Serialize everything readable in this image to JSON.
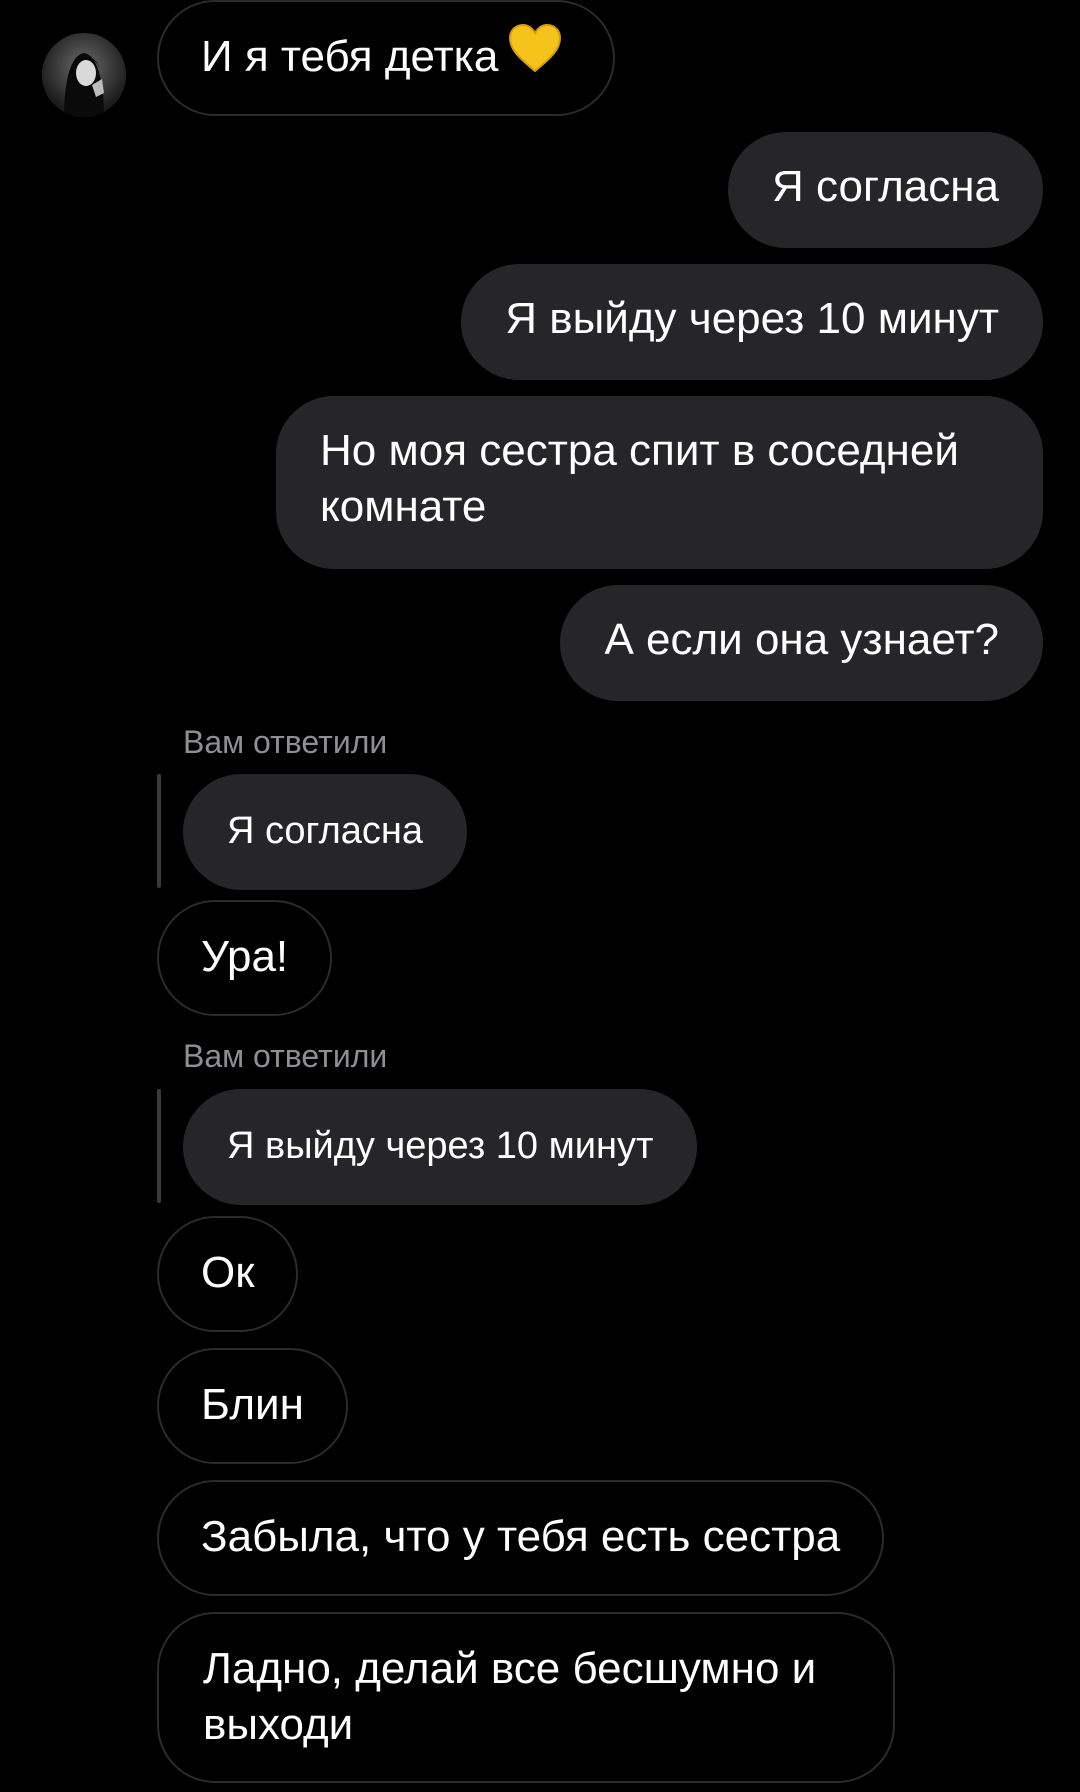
{
  "messages": {
    "m1": "И я тебя детка",
    "m2": "Я согласна",
    "m3": "Я выйду через 10 минут",
    "m4": "Но моя сестра спит в соседней комнате",
    "m5": "А если она узнает?",
    "reply1_label": "Вам ответили",
    "reply1_quote": "Я согласна",
    "m6": "Ура!",
    "reply2_label": "Вам ответили",
    "reply2_quote": "Я выйду через 10 минут",
    "m7": "Ок",
    "m8": "Блин",
    "m9": "Забыла, что у тебя есть сестра",
    "m10": "Ладно, делай все бесшумно и выходи"
  },
  "icons": {
    "heart": "yellow-heart-icon",
    "avatar": "avatar"
  },
  "colors": {
    "background": "#000000",
    "outgoing_bubble": "#262628",
    "incoming_border": "#2b2b2e",
    "reply_label": "#8e8e93",
    "heart": "#f6c21c"
  }
}
